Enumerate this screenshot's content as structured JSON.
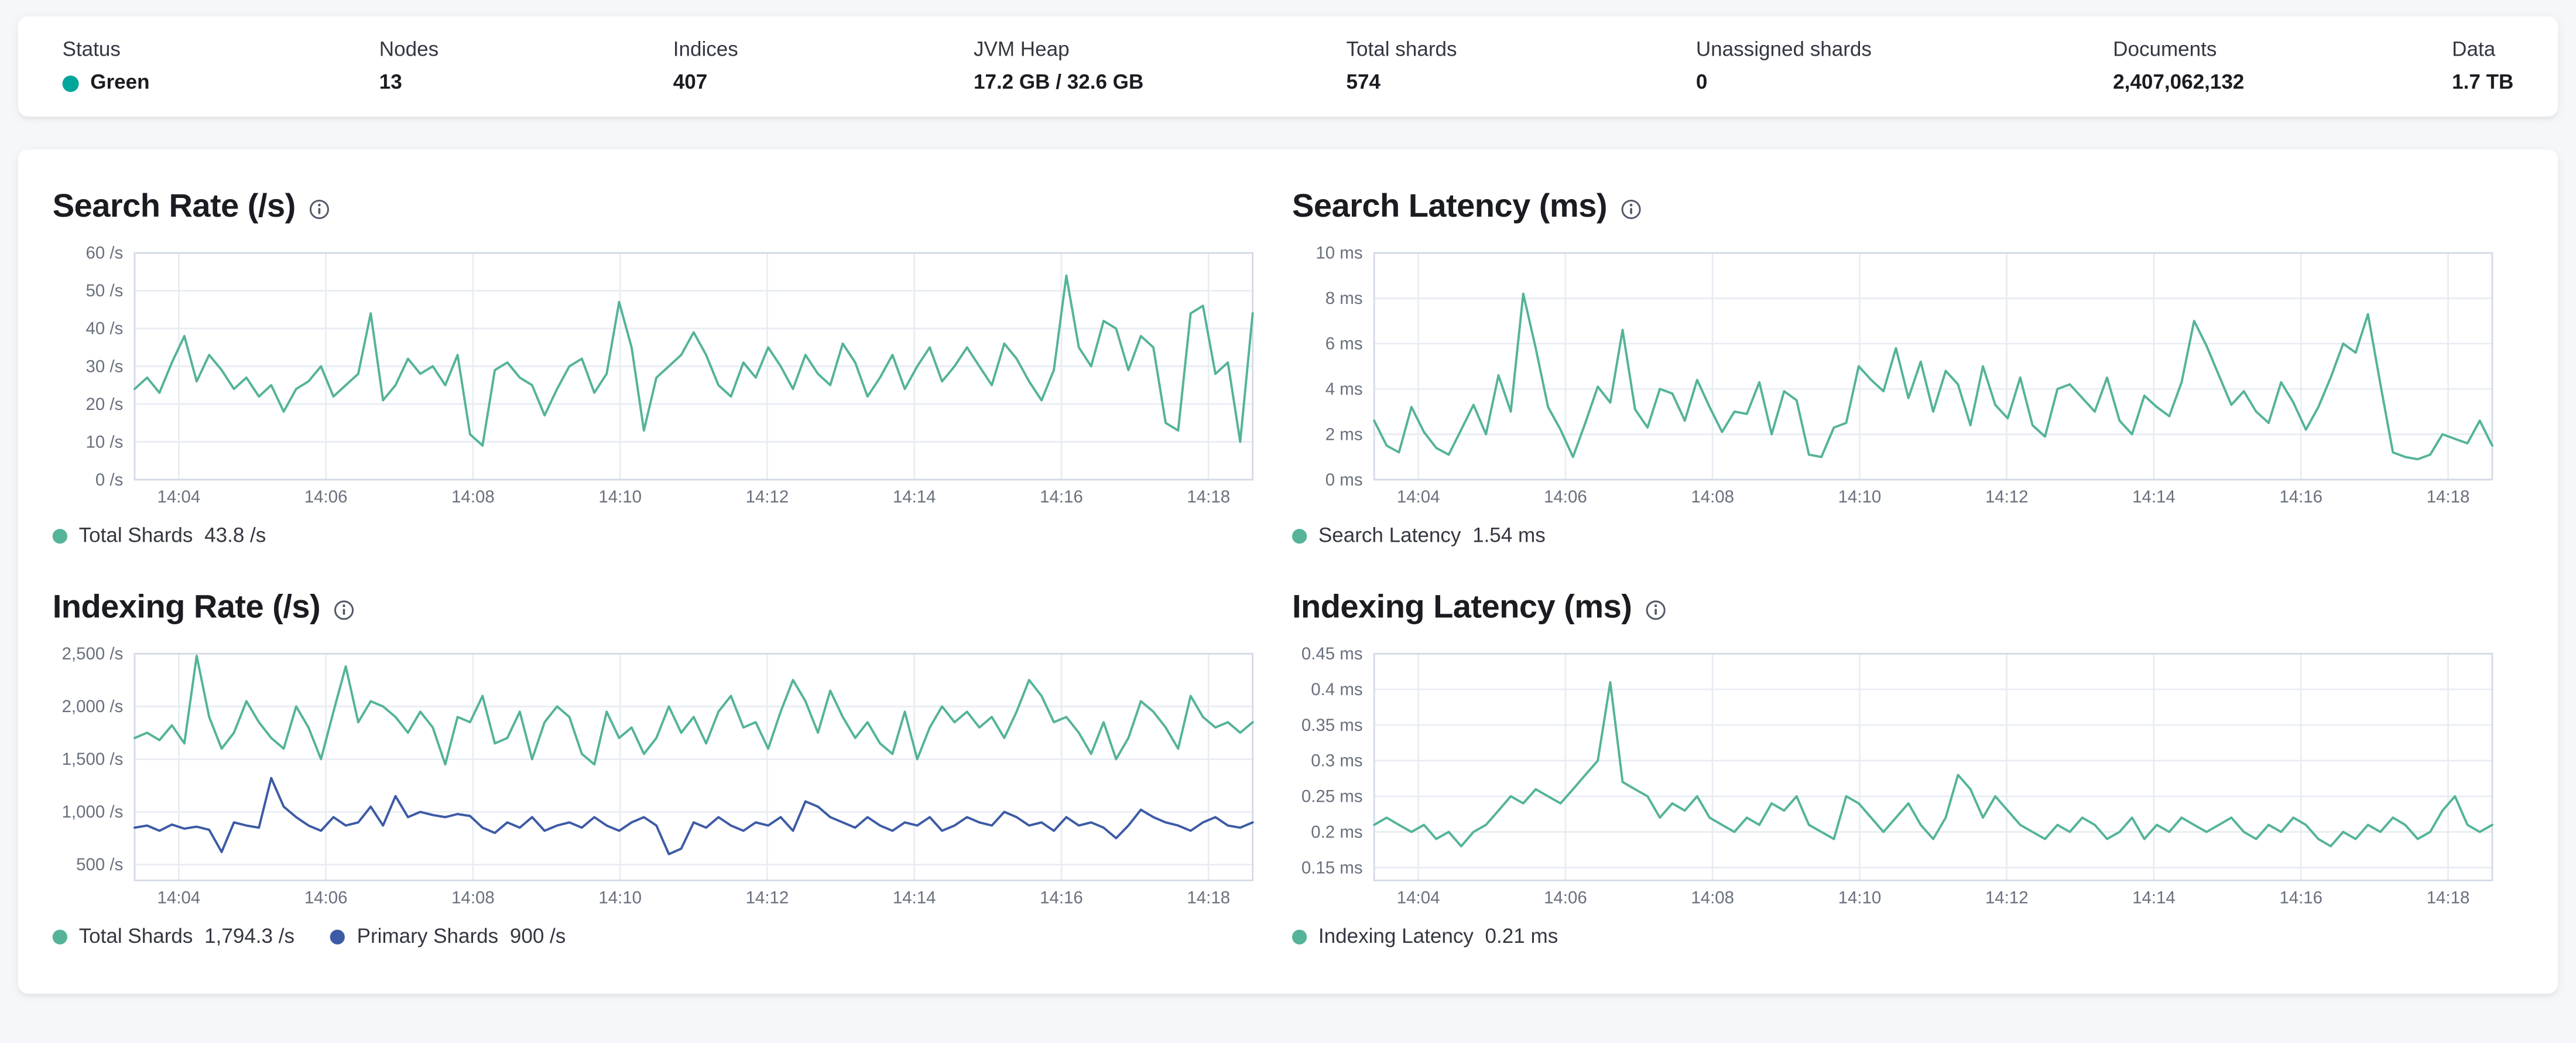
{
  "palette": {
    "teal": "#54b399",
    "blue": "#3c5aa5",
    "health_green": "#00a69b",
    "grid_line": "#e9edf3",
    "plot_border": "#d3dae6",
    "axis_text": "#69707d"
  },
  "icons": {
    "info": "circle-i",
    "health": "status-dot"
  },
  "summary": {
    "items": [
      {
        "label": "Status",
        "value": "Green",
        "dot_color": "#00a69b"
      },
      {
        "label": "Nodes",
        "value": "13"
      },
      {
        "label": "Indices",
        "value": "407"
      },
      {
        "label": "JVM Heap",
        "value": "17.2 GB / 32.6 GB"
      },
      {
        "label": "Total shards",
        "value": "574"
      },
      {
        "label": "Unassigned shards",
        "value": "0"
      },
      {
        "label": "Documents",
        "value": "2,407,062,132"
      },
      {
        "label": "Data",
        "value": "1.7 TB"
      }
    ]
  },
  "charts": [
    {
      "title": "Search Rate (/s)",
      "legend": [
        {
          "label": "Total Shards",
          "value": "43.8 /s",
          "color": "#54b399"
        }
      ],
      "chart_data": {
        "type": "line",
        "x_axis": {
          "lim": [
            3.4,
            18.6
          ],
          "ticks": [
            {
              "v": 4,
              "label": "14:04"
            },
            {
              "v": 6,
              "label": "14:06"
            },
            {
              "v": 8,
              "label": "14:08"
            },
            {
              "v": 10,
              "label": "14:10"
            },
            {
              "v": 12,
              "label": "14:12"
            },
            {
              "v": 14,
              "label": "14:14"
            },
            {
              "v": 16,
              "label": "14:16"
            },
            {
              "v": 18,
              "label": "14:18"
            }
          ]
        },
        "y_axis": {
          "lim": [
            0,
            60
          ],
          "ticks": [
            {
              "v": 0,
              "label": "0 /s"
            },
            {
              "v": 10,
              "label": "10 /s"
            },
            {
              "v": 20,
              "label": "20 /s"
            },
            {
              "v": 30,
              "label": "30 /s"
            },
            {
              "v": 40,
              "label": "40 /s"
            },
            {
              "v": 50,
              "label": "50 /s"
            },
            {
              "v": 60,
              "label": "60 /s"
            }
          ]
        },
        "series": [
          {
            "name": "Total Shards",
            "color": "#54b399",
            "values": [
              24,
              27,
              23,
              31,
              38,
              26,
              33,
              29,
              24,
              27,
              22,
              25,
              18,
              24,
              26,
              30,
              22,
              25,
              28,
              44,
              21,
              25,
              32,
              28,
              30,
              25,
              33,
              12,
              9,
              29,
              31,
              27,
              25,
              17,
              24,
              30,
              32,
              23,
              28,
              47,
              35,
              13,
              27,
              30,
              33,
              39,
              33,
              25,
              22,
              31,
              27,
              35,
              30,
              24,
              33,
              28,
              25,
              36,
              31,
              22,
              27,
              33,
              24,
              30,
              35,
              26,
              30,
              35,
              30,
              25,
              36,
              32,
              26,
              21,
              29,
              54,
              35,
              30,
              42,
              40,
              29,
              38,
              35,
              15,
              13,
              44,
              46,
              28,
              31,
              10,
              44
            ]
          }
        ]
      }
    },
    {
      "title": "Search Latency (ms)",
      "legend": [
        {
          "label": "Search Latency",
          "value": "1.54 ms",
          "color": "#54b399"
        }
      ],
      "chart_data": {
        "type": "line",
        "x_axis": {
          "lim": [
            3.4,
            18.6
          ],
          "ticks": [
            {
              "v": 4,
              "label": "14:04"
            },
            {
              "v": 6,
              "label": "14:06"
            },
            {
              "v": 8,
              "label": "14:08"
            },
            {
              "v": 10,
              "label": "14:10"
            },
            {
              "v": 12,
              "label": "14:12"
            },
            {
              "v": 14,
              "label": "14:14"
            },
            {
              "v": 16,
              "label": "14:16"
            },
            {
              "v": 18,
              "label": "14:18"
            }
          ]
        },
        "y_axis": {
          "lim": [
            0,
            10
          ],
          "ticks": [
            {
              "v": 0,
              "label": "0 ms"
            },
            {
              "v": 2,
              "label": "2 ms"
            },
            {
              "v": 4,
              "label": "4 ms"
            },
            {
              "v": 6,
              "label": "6 ms"
            },
            {
              "v": 8,
              "label": "8 ms"
            },
            {
              "v": 10,
              "label": "10 ms"
            }
          ]
        },
        "series": [
          {
            "name": "Search Latency",
            "color": "#54b399",
            "values": [
              2.6,
              1.5,
              1.2,
              3.2,
              2.1,
              1.4,
              1.1,
              2.2,
              3.3,
              2.0,
              4.6,
              3.0,
              8.2,
              5.8,
              3.2,
              2.2,
              1.0,
              2.5,
              4.1,
              3.4,
              6.6,
              3.1,
              2.3,
              4.0,
              3.8,
              2.6,
              4.4,
              3.2,
              2.1,
              3.0,
              2.9,
              4.3,
              2.0,
              3.9,
              3.5,
              1.1,
              1.0,
              2.3,
              2.5,
              5.0,
              4.4,
              3.9,
              5.8,
              3.6,
              5.2,
              3.0,
              4.8,
              4.2,
              2.4,
              5.0,
              3.3,
              2.7,
              4.5,
              2.4,
              1.9,
              4.0,
              4.2,
              3.6,
              3.0,
              4.5,
              2.6,
              2.0,
              3.7,
              3.2,
              2.8,
              4.3,
              7.0,
              5.9,
              4.6,
              3.3,
              3.9,
              3.0,
              2.5,
              4.3,
              3.4,
              2.2,
              3.2,
              4.5,
              6.0,
              5.6,
              7.3,
              4.2,
              1.2,
              1.0,
              0.9,
              1.1,
              2.0,
              1.8,
              1.6,
              2.6,
              1.5
            ]
          }
        ]
      }
    },
    {
      "title": "Indexing Rate (/s)",
      "legend": [
        {
          "label": "Total Shards",
          "value": "1,794.3 /s",
          "color": "#54b399"
        },
        {
          "label": "Primary Shards",
          "value": "900 /s",
          "color": "#3c5aa5"
        }
      ],
      "chart_data": {
        "type": "line",
        "x_axis": {
          "lim": [
            3.4,
            18.6
          ],
          "ticks": [
            {
              "v": 4,
              "label": "14:04"
            },
            {
              "v": 6,
              "label": "14:06"
            },
            {
              "v": 8,
              "label": "14:08"
            },
            {
              "v": 10,
              "label": "14:10"
            },
            {
              "v": 12,
              "label": "14:12"
            },
            {
              "v": 14,
              "label": "14:14"
            },
            {
              "v": 16,
              "label": "14:16"
            },
            {
              "v": 18,
              "label": "14:18"
            }
          ]
        },
        "y_axis": {
          "lim": [
            350,
            2500
          ],
          "ticks": [
            {
              "v": 500,
              "label": "500 /s"
            },
            {
              "v": 1000,
              "label": "1,000 /s"
            },
            {
              "v": 1500,
              "label": "1,500 /s"
            },
            {
              "v": 2000,
              "label": "2,000 /s"
            },
            {
              "v": 2500,
              "label": "2,500 /s"
            }
          ]
        },
        "series": [
          {
            "name": "Total Shards",
            "color": "#54b399",
            "values": [
              1700,
              1750,
              1680,
              1820,
              1650,
              2480,
              1900,
              1600,
              1750,
              2050,
              1850,
              1700,
              1600,
              2000,
              1800,
              1500,
              1950,
              2380,
              1850,
              2050,
              2000,
              1900,
              1750,
              1950,
              1800,
              1450,
              1900,
              1850,
              2100,
              1650,
              1700,
              1950,
              1500,
              1850,
              2000,
              1900,
              1550,
              1450,
              1950,
              1700,
              1800,
              1550,
              1700,
              2000,
              1750,
              1900,
              1650,
              1950,
              2100,
              1800,
              1850,
              1600,
              1950,
              2250,
              2050,
              1750,
              2150,
              1900,
              1700,
              1850,
              1650,
              1550,
              1950,
              1500,
              1800,
              2000,
              1850,
              1950,
              1800,
              1900,
              1700,
              1950,
              2250,
              2100,
              1850,
              1900,
              1750,
              1550,
              1850,
              1500,
              1700,
              2050,
              1950,
              1800,
              1600,
              2100,
              1900,
              1800,
              1850,
              1750,
              1850
            ]
          },
          {
            "name": "Primary Shards",
            "color": "#3c5aa5",
            "values": [
              850,
              870,
              820,
              880,
              840,
              860,
              830,
              620,
              900,
              870,
              850,
              1320,
              1050,
              950,
              870,
              820,
              950,
              870,
              900,
              1050,
              870,
              1150,
              950,
              1000,
              970,
              950,
              980,
              960,
              850,
              800,
              900,
              850,
              950,
              820,
              870,
              900,
              850,
              950,
              870,
              820,
              900,
              950,
              870,
              600,
              650,
              900,
              850,
              950,
              870,
              820,
              900,
              870,
              950,
              820,
              1100,
              1050,
              950,
              900,
              850,
              950,
              870,
              820,
              900,
              870,
              950,
              820,
              870,
              950,
              900,
              870,
              1000,
              950,
              870,
              900,
              820,
              950,
              870,
              900,
              850,
              750,
              870,
              1020,
              950,
              900,
              870,
              820,
              900,
              950,
              870,
              850,
              900
            ]
          }
        ]
      }
    },
    {
      "title": "Indexing Latency (ms)",
      "legend": [
        {
          "label": "Indexing Latency",
          "value": "0.21 ms",
          "color": "#54b399"
        }
      ],
      "chart_data": {
        "type": "line",
        "x_axis": {
          "lim": [
            3.4,
            18.6
          ],
          "ticks": [
            {
              "v": 4,
              "label": "14:04"
            },
            {
              "v": 6,
              "label": "14:06"
            },
            {
              "v": 8,
              "label": "14:08"
            },
            {
              "v": 10,
              "label": "14:10"
            },
            {
              "v": 12,
              "label": "14:12"
            },
            {
              "v": 14,
              "label": "14:14"
            },
            {
              "v": 16,
              "label": "14:16"
            },
            {
              "v": 18,
              "label": "14:18"
            }
          ]
        },
        "y_axis": {
          "lim": [
            0.132,
            0.45
          ],
          "ticks": [
            {
              "v": 0.15,
              "label": "0.15 ms"
            },
            {
              "v": 0.2,
              "label": "0.2 ms"
            },
            {
              "v": 0.25,
              "label": "0.25 ms"
            },
            {
              "v": 0.3,
              "label": "0.3 ms"
            },
            {
              "v": 0.35,
              "label": "0.35 ms"
            },
            {
              "v": 0.4,
              "label": "0.4 ms"
            },
            {
              "v": 0.45,
              "label": "0.45 ms"
            }
          ]
        },
        "series": [
          {
            "name": "Indexing Latency",
            "color": "#54b399",
            "values": [
              0.21,
              0.22,
              0.21,
              0.2,
              0.21,
              0.19,
              0.2,
              0.18,
              0.2,
              0.21,
              0.23,
              0.25,
              0.24,
              0.26,
              0.25,
              0.24,
              0.26,
              0.28,
              0.3,
              0.41,
              0.27,
              0.26,
              0.25,
              0.22,
              0.24,
              0.23,
              0.25,
              0.22,
              0.21,
              0.2,
              0.22,
              0.21,
              0.24,
              0.23,
              0.25,
              0.21,
              0.2,
              0.19,
              0.25,
              0.24,
              0.22,
              0.2,
              0.22,
              0.24,
              0.21,
              0.19,
              0.22,
              0.28,
              0.26,
              0.22,
              0.25,
              0.23,
              0.21,
              0.2,
              0.19,
              0.21,
              0.2,
              0.22,
              0.21,
              0.19,
              0.2,
              0.22,
              0.19,
              0.21,
              0.2,
              0.22,
              0.21,
              0.2,
              0.21,
              0.22,
              0.2,
              0.19,
              0.21,
              0.2,
              0.22,
              0.21,
              0.19,
              0.18,
              0.2,
              0.19,
              0.21,
              0.2,
              0.22,
              0.21,
              0.19,
              0.2,
              0.23,
              0.25,
              0.21,
              0.2,
              0.21
            ]
          }
        ]
      }
    }
  ]
}
